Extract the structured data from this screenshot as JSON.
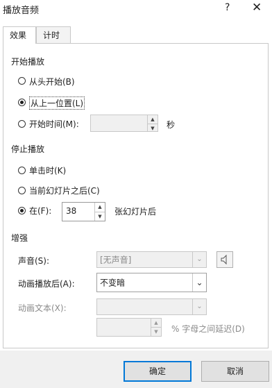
{
  "window": {
    "title": "播放音频",
    "help": "?",
    "close": "✕"
  },
  "tabs": [
    {
      "label": "效果",
      "active": true
    },
    {
      "label": "计时",
      "active": false
    }
  ],
  "start": {
    "heading": "开始播放",
    "opt_from_start": "从头开始(B)",
    "opt_from_last": "从上一位置(L)",
    "opt_start_time": "开始时间(M):",
    "seconds_unit": "秒"
  },
  "stop": {
    "heading": "停止播放",
    "opt_on_click": "单击时(K)",
    "opt_after_current": "当前幻灯片之后(C)",
    "opt_after": "在(F):",
    "after_value": "38",
    "after_suffix": "张幻灯片后"
  },
  "enhance": {
    "heading": "增强",
    "sound_label": "声音(S):",
    "sound_value": "[无声音]",
    "after_anim_label": "动画播放后(A):",
    "after_anim_value": "不变暗",
    "anim_text_label": "动画文本(X):",
    "delay_label": "% 字母之间延迟(D)"
  },
  "footer": {
    "ok": "确定",
    "cancel": "取消"
  },
  "colors": {
    "accent": "#0078d7",
    "footer_bg": "#f0f0f0"
  },
  "icons": {
    "help": "help-icon",
    "close": "close-icon",
    "speaker": "speaker-icon",
    "dropdown": "chevron-down-icon",
    "spin_up": "spin-up-icon",
    "spin_down": "spin-down-icon"
  }
}
